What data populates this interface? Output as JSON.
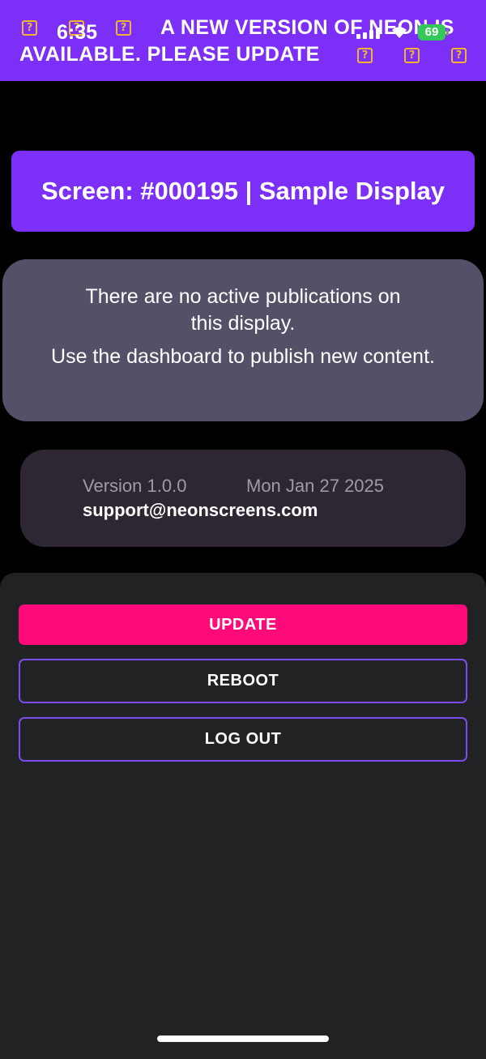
{
  "banner": {
    "message": "A NEW VERSION OF NEON IS AVAILABLE. PLEASE UPDATE",
    "glyph": "?"
  },
  "status_bar": {
    "time": "6:35",
    "battery_level": "69",
    "icons": [
      "signal-icon",
      "wifi-icon",
      "battery-icon"
    ]
  },
  "screen": {
    "title": "Screen: #000195 | Sample Display"
  },
  "notice": {
    "line_1": "There are no active publications on this display.",
    "line_2": "Use the dashboard to publish new content."
  },
  "info": {
    "version": "Version 1.0.0",
    "date": "Mon Jan 27 2025",
    "support_email": "support@neonscreens.com"
  },
  "actions": {
    "update_label": "UPDATE",
    "reboot_label": "REBOOT",
    "logout_label": "LOG OUT"
  },
  "colors": {
    "brand_purple": "#7b2ff7",
    "update_pink": "#ff0a78",
    "outline_purple": "#7b4df0",
    "battery_green": "#34c759",
    "missing_glyph_orange": "#f2b233"
  }
}
